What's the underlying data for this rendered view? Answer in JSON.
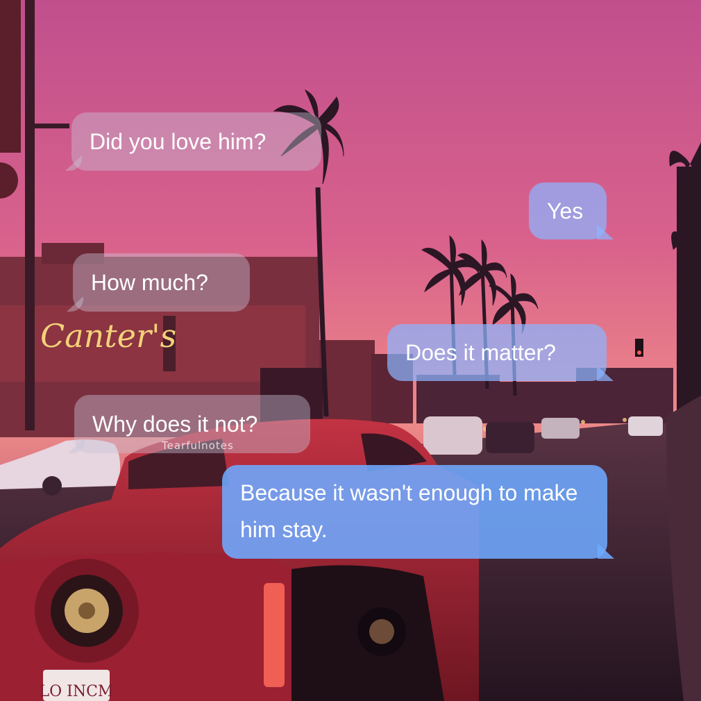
{
  "messages": [
    {
      "sender": "them",
      "text": "Did you love him?"
    },
    {
      "sender": "me",
      "text": "Yes"
    },
    {
      "sender": "them",
      "text": "How much?"
    },
    {
      "sender": "me",
      "text": "Does it matter?"
    },
    {
      "sender": "them",
      "text": "Why does it not?"
    },
    {
      "sender": "me",
      "text": "Because it wasn't enough to make him stay."
    }
  ],
  "watermark": "Tearfulnotes",
  "scene": {
    "storefront_sign": "Canter's",
    "license_plate": "LO INCM",
    "colors": {
      "sky_top": "#c7588f",
      "sky_mid": "#e0708a",
      "sky_horizon": "#f39a86",
      "building": "#7a2f3e",
      "car_body": "#a3283a",
      "incoming_bubble": "#c8c3d7",
      "outgoing_bubble": "#8cb4ff"
    }
  }
}
